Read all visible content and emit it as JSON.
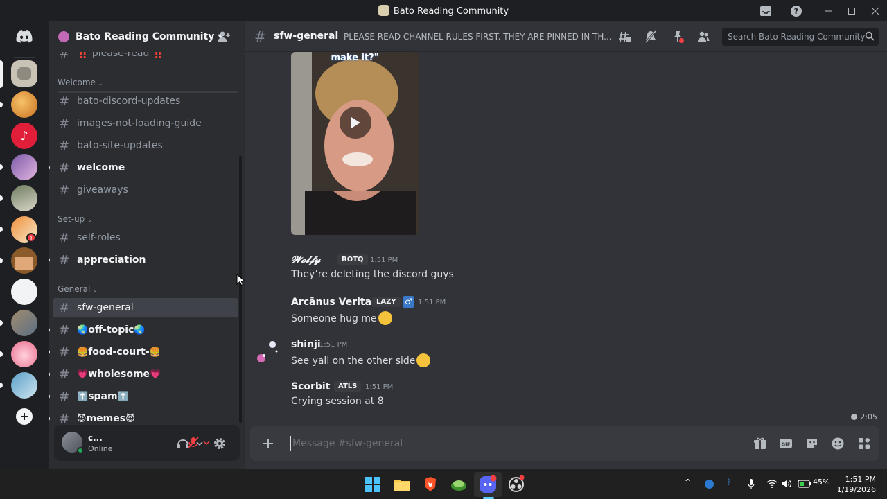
{
  "window": {
    "title": "Bato Reading Community"
  },
  "guild": {
    "name": "Bato Reading Community"
  },
  "sidebar": {
    "partial_top": "‼️ please-read ‼️",
    "categories": [
      {
        "label": "Welcome"
      },
      {
        "label": "Set-up"
      },
      {
        "label": "General"
      }
    ],
    "channels": [
      {
        "label": "bato-discord-updates",
        "state": "read"
      },
      {
        "label": "images-not-loading-guide",
        "state": "read"
      },
      {
        "label": "bato-site-updates",
        "state": "read"
      },
      {
        "label": "welcome",
        "state": "unread"
      },
      {
        "label": "giveaways",
        "state": "read"
      },
      {
        "label": "self-roles",
        "state": "read"
      },
      {
        "label": "appreciation",
        "state": "unread"
      },
      {
        "label": "sfw-general",
        "state": "active"
      },
      {
        "label": "off-topic",
        "state": "unread",
        "prefix": "🌏",
        "suffix": "🌏"
      },
      {
        "label": "food-court-",
        "state": "unread",
        "prefix": "🍔",
        "suffix": "🍔"
      },
      {
        "label": "wholesome",
        "state": "unread",
        "prefix": "💗",
        "suffix": "💗"
      },
      {
        "label": "spam",
        "state": "unread",
        "prefix": "⬆️",
        "suffix": "⬆️"
      },
      {
        "label": "memes",
        "state": "unread",
        "prefix": "😈",
        "suffix": "😈"
      }
    ]
  },
  "user": {
    "name": "c...",
    "status": "Online"
  },
  "header": {
    "channel": "sfw-general",
    "topic": "PLEASE READ CHANNEL RULES FIRST. THEY ARE PINNED IN TH...",
    "search_placeholder": "Search Bato Reading Community"
  },
  "messages": {
    "video_caption": "make it?\"",
    "items": [
      {
        "author": "𝓦𝓸𝓵𝓯𝔂",
        "tag": "ROTQ",
        "time": "1:51 PM",
        "text": "They’re deleting the discord guys"
      },
      {
        "author": "Arcānus Veritas",
        "tag": "LAZY",
        "time": "1:51 PM",
        "text": "Someone hug me"
      },
      {
        "author": "shinji",
        "tag": "",
        "time": "1:51 PM",
        "text": "See yall on the other side"
      },
      {
        "author": "Scorbit",
        "tag": "ATLS",
        "time": "1:51 PM",
        "text": "Crying session at 8"
      }
    ],
    "voice_timer": "2:05"
  },
  "composer": {
    "placeholder": "Message #sfw-general"
  },
  "taskbar": {
    "battery": "45%",
    "time": "1:51 PM",
    "date": "1/19/2026"
  },
  "icons": {
    "rail_home": "discord-logo-icon",
    "add_server": "plus-icon",
    "invite": "person-add-icon",
    "threads": "threads-icon",
    "mute_notifications": "bell-slash-icon",
    "pinned": "pin-icon",
    "members": "members-icon",
    "search": "search-icon",
    "gift": "gift-icon",
    "gif": "gif-icon",
    "sticker": "sticker-icon",
    "emoji": "emoji-icon",
    "apps": "apps-icon"
  },
  "colors": {
    "accent": "#5865f2",
    "online": "#23a55a",
    "mention": "#f23f43"
  }
}
